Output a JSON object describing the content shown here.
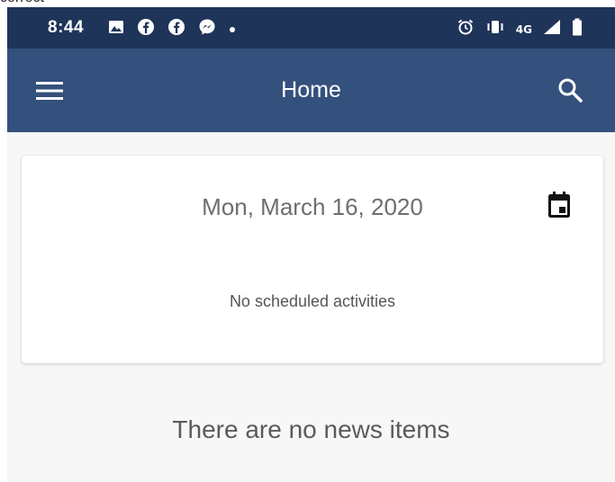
{
  "crop_text": "correct",
  "status_bar": {
    "time": "8:44",
    "left_icons": [
      "image-icon",
      "facebook-icon",
      "facebook-icon",
      "messenger-icon",
      "dot-icon"
    ],
    "right_icons": [
      "alarm-icon",
      "vibrate-icon",
      "signal-icon",
      "battery-icon"
    ],
    "network": "4G",
    "background": "#1f3459"
  },
  "app_bar": {
    "title": "Home",
    "menu_icon": "hamburger-menu-icon",
    "search_icon": "search-icon",
    "background": "#34507d"
  },
  "schedule_card": {
    "date": "Mon, March 16, 2020",
    "calendar_icon": "calendar-icon",
    "empty_message": "No scheduled activities"
  },
  "news": {
    "empty_message": "There are no news items"
  }
}
